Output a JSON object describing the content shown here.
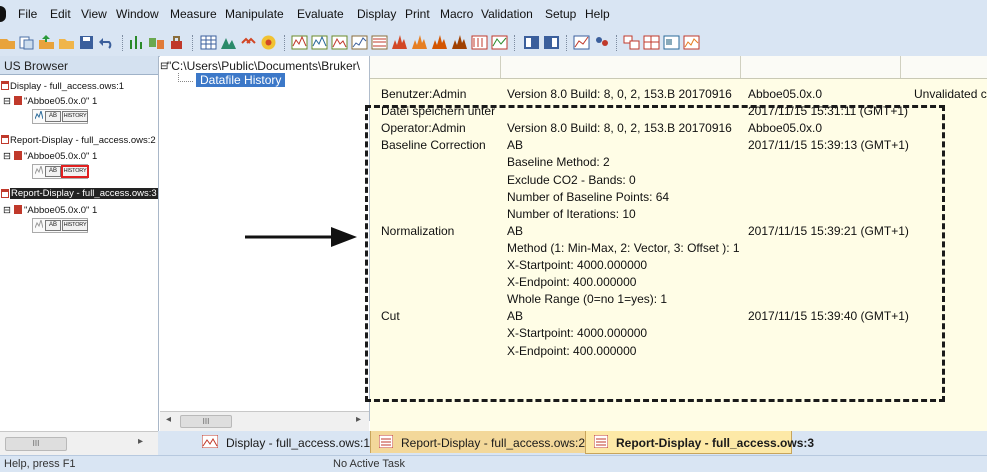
{
  "menu": {
    "items": [
      "File",
      "Edit",
      "View",
      "Window",
      "Measure",
      "Manipulate",
      "Evaluate",
      "Display",
      "Print",
      "Macro",
      "Validation",
      "Setup",
      "Help"
    ]
  },
  "toolbar": {
    "icons": [
      "open-file-icon",
      "print-icon",
      "save-icon",
      "undo-icon",
      "measure-icon",
      "manipulate-icon",
      "evaluate-icon",
      "display-icon"
    ]
  },
  "opus_browser": {
    "title": "US Browser",
    "items": [
      {
        "label": "Display - full_access.ows:1",
        "child": "\"Abboe05.0x.0\" 1"
      },
      {
        "label": "Report-Display - full_access.ows:2",
        "child": "\"Abboe05.0x.0\" 1"
      },
      {
        "label": "Report-Display - full_access.ows:3",
        "child": "\"Abboe05.0x.0\" 1"
      }
    ],
    "ab_label": "AB",
    "history_label": "HISTORY"
  },
  "middle": {
    "path": "\"C:\\Users\\Public\\Documents\\Bruker\\",
    "history_item": "Datafile History"
  },
  "grid": {
    "rows": [
      {
        "c1": "Benutzer:Admin",
        "c2": "Version 8.0 Build: 8, 0, 2, 153.B 20170916",
        "c3": "Abboe05.0x.0",
        "c4": "Unvalidated c"
      },
      {
        "c1": "Datei speichern unter",
        "c2": "",
        "c3": "2017/11/15 15:31:11 (GMT+1)",
        "c4": ""
      },
      {
        "c1": "Operator:Admin",
        "c2": "Version 8.0 Build: 8, 0, 2, 153.B 20170916",
        "c3": "Abboe05.0x.0",
        "c4": ""
      },
      {
        "c1": "Baseline Correction",
        "c2": "AB",
        "c3": "2017/11/15 15:39:13 (GMT+1)",
        "c4": ""
      },
      {
        "c1": "",
        "c2": "Baseline Method: 2",
        "c3": "",
        "c4": ""
      },
      {
        "c1": "",
        "c2": "Exclude CO2 - Bands: 0",
        "c3": "",
        "c4": ""
      },
      {
        "c1": "",
        "c2": "Number of Baseline Points: 64",
        "c3": "",
        "c4": ""
      },
      {
        "c1": "",
        "c2": "Number of Iterations: 10",
        "c3": "",
        "c4": ""
      },
      {
        "c1": "Normalization",
        "c2": "AB",
        "c3": "2017/11/15 15:39:21 (GMT+1)",
        "c4": ""
      },
      {
        "c1": "",
        "c2": "Method (1: Min-Max, 2: Vector, 3: Offset ): 1",
        "c3": "",
        "c4": ""
      },
      {
        "c1": "",
        "c2": "X-Startpoint: 4000.000000",
        "c3": "",
        "c4": ""
      },
      {
        "c1": "",
        "c2": "X-Endpoint: 400.000000",
        "c3": "",
        "c4": ""
      },
      {
        "c1": "",
        "c2": "Whole Range (0=no 1=yes): 1",
        "c3": "",
        "c4": ""
      },
      {
        "c1": "Cut",
        "c2": "AB",
        "c3": "2017/11/15 15:39:40 (GMT+1)",
        "c4": ""
      },
      {
        "c1": "",
        "c2": "X-Startpoint: 4000.000000",
        "c3": "",
        "c4": ""
      },
      {
        "c1": "",
        "c2": "X-Endpoint: 400.000000",
        "c3": "",
        "c4": ""
      }
    ]
  },
  "scroll": {
    "left_label": "III",
    "mid_label": "III"
  },
  "tabs": [
    {
      "label": "Display - full_access.ows:1"
    },
    {
      "label": "Report-Display - full_access.ows:2"
    },
    {
      "label": "Report-Display - full_access.ows:3"
    }
  ],
  "status": {
    "help": "Help, press F1",
    "task": "No Active Task"
  },
  "colors": {
    "chrome": "#d9e5f3",
    "grid_bg": "#fffde6",
    "selection": "#3c78c8",
    "active_tab": "#fde9a7"
  }
}
